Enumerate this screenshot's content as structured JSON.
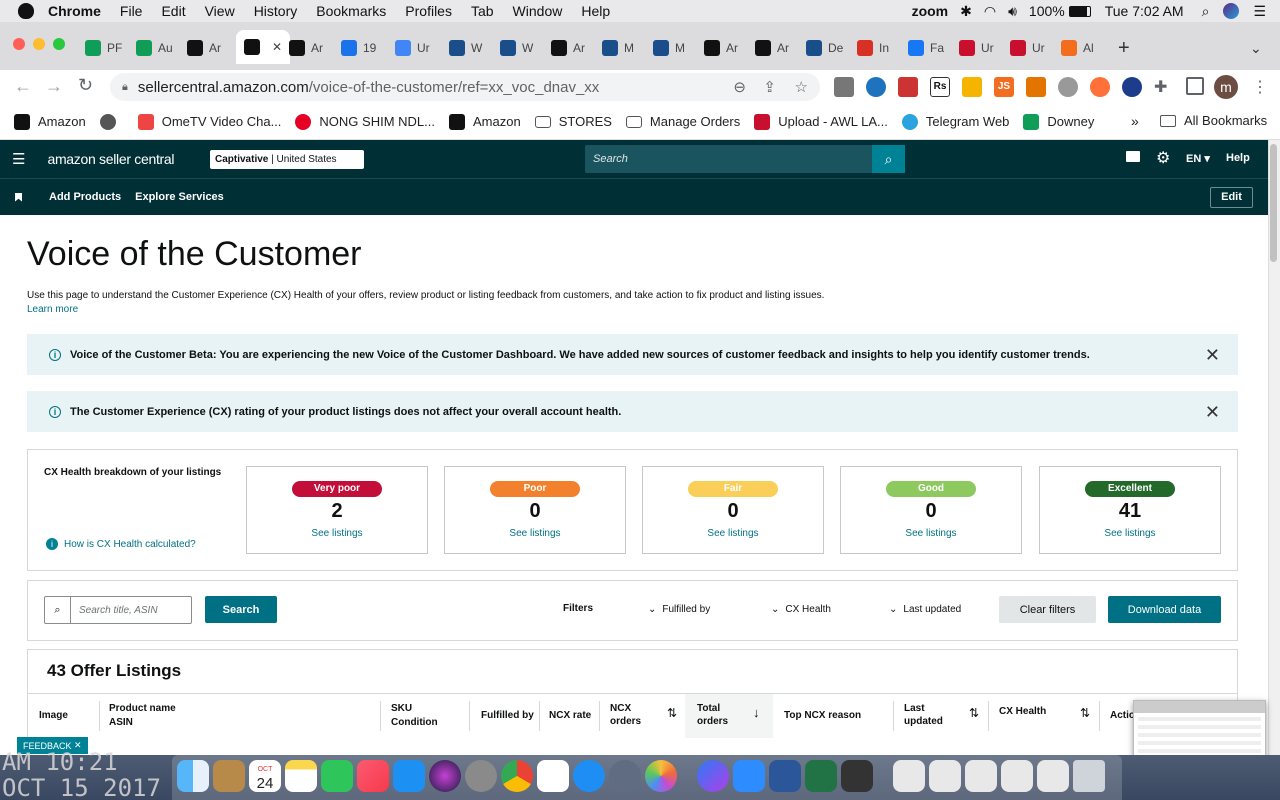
{
  "menubar": {
    "app": "Chrome",
    "items": [
      "File",
      "Edit",
      "View",
      "History",
      "Bookmarks",
      "Profiles",
      "Tab",
      "Window",
      "Help"
    ],
    "zoom": "zoom",
    "battery": "100%",
    "clock": "Tue 7:02 AM"
  },
  "tabs": [
    {
      "label": "PF",
      "icon": "sheets-icon",
      "color": "#0f9d58"
    },
    {
      "label": "Au",
      "icon": "sheets-icon",
      "color": "#0f9d58"
    },
    {
      "label": "Ar",
      "icon": "amazon-icon",
      "color": "#111"
    },
    {
      "label": "",
      "icon": "amazon-icon",
      "color": "#111",
      "active": true
    },
    {
      "label": "Ar",
      "icon": "amazon-icon",
      "color": "#111"
    },
    {
      "label": "19",
      "icon": "badge-icon",
      "color": "#1a73e8"
    },
    {
      "label": "Ur",
      "icon": "docs-icon",
      "color": "#4285f4"
    },
    {
      "label": "W",
      "icon": "cube-icon",
      "color": "#1a4e8a"
    },
    {
      "label": "W",
      "icon": "cube-icon",
      "color": "#1a4e8a"
    },
    {
      "label": "Ar",
      "icon": "amazon-icon",
      "color": "#111"
    },
    {
      "label": "M",
      "icon": "cube-icon",
      "color": "#1a4e8a"
    },
    {
      "label": "M",
      "icon": "cube-icon",
      "color": "#1a4e8a"
    },
    {
      "label": "Ar",
      "icon": "amazon-icon",
      "color": "#111"
    },
    {
      "label": "Ar",
      "icon": "amazon-icon",
      "color": "#111"
    },
    {
      "label": "De",
      "icon": "cube-icon",
      "color": "#1a4e8a"
    },
    {
      "label": "In",
      "icon": "gmail-icon",
      "color": "#d93025"
    },
    {
      "label": "Fa",
      "icon": "facebook-icon",
      "color": "#1877f2"
    },
    {
      "label": "Ur",
      "icon": "awl-icon",
      "color": "#c8102e"
    },
    {
      "label": "Ur",
      "icon": "awl-icon",
      "color": "#c8102e"
    },
    {
      "label": "Al",
      "icon": "pen-icon",
      "color": "#f36d21"
    }
  ],
  "url": {
    "host": "sellercentral.amazon.com",
    "path": "/voice-of-the-customer/ref=xx_voc_dnav_xx"
  },
  "profile_initial": "m",
  "bookmarks": [
    {
      "label": "Amazon",
      "icon": "amazon-icon"
    },
    {
      "label": "",
      "icon": "globe-icon"
    },
    {
      "label": "OmeTV Video Cha...",
      "icon": "ometv-icon"
    },
    {
      "label": "NONG SHIM NDL...",
      "icon": "pinterest-icon"
    },
    {
      "label": "Amazon",
      "icon": "amazon-icon"
    },
    {
      "label": "STORES",
      "icon": "folder-icon"
    },
    {
      "label": "Manage Orders",
      "icon": "folder-icon"
    },
    {
      "label": "Upload - AWL LA...",
      "icon": "awl-icon"
    },
    {
      "label": "Telegram Web",
      "icon": "telegram-icon"
    },
    {
      "label": "Downey",
      "icon": "sheets-icon"
    }
  ],
  "all_bookmarks": "All Bookmarks",
  "sc": {
    "logo": "amazon seller central",
    "store": "Captivative",
    "market": "United States",
    "search_placeholder": "Search",
    "lang": "EN",
    "help": "Help",
    "nav": [
      "Add Products",
      "Explore Services"
    ],
    "edit": "Edit"
  },
  "page": {
    "title": "Voice of the Customer",
    "desc": "Use this page to understand the Customer Experience (CX) Health of your offers, review product or listing feedback from customers, and take action to fix product and listing issues.",
    "learn_more": "Learn more",
    "banner1": "Voice of the Customer Beta: You are experiencing the new Voice of the Customer Dashboard. We have added new sources of customer feedback and insights to help you identify customer trends.",
    "banner2": "The Customer Experience (CX) rating of your product listings does not affect your overall account health.",
    "breakdown_title": "CX Health breakdown of your listings",
    "how_calc": "How is CX Health calculated?",
    "cards": [
      {
        "label": "Very poor",
        "count": "2",
        "see": "See listings",
        "color": "#c40e3a"
      },
      {
        "label": "Poor",
        "count": "0",
        "see": "See listings",
        "color": "#f3802c"
      },
      {
        "label": "Fair",
        "count": "0",
        "see": "See listings",
        "color": "#f9cf59"
      },
      {
        "label": "Good",
        "count": "0",
        "see": "See listings",
        "color": "#8ec95f"
      },
      {
        "label": "Excellent",
        "count": "41",
        "see": "See listings",
        "color": "#23692a"
      }
    ],
    "search_placeholder": "Search title, ASIN",
    "search_btn": "Search",
    "filters": "Filters",
    "filter_fulfilled": "Fulfilled by",
    "filter_cx": "CX Health",
    "filter_updated": "Last updated",
    "clear_filters": "Clear filters",
    "download": "Download data",
    "listings_title": "43 Offer Listings",
    "columns": {
      "image": "Image",
      "product_name": "Product name",
      "asin": "ASIN",
      "sku": "SKU",
      "condition": "Condition",
      "fulfilled": "Fulfilled by",
      "ncx_rate": "NCX rate",
      "ncx_orders_1": "NCX",
      "ncx_orders_2": "orders",
      "total_orders_1": "Total",
      "total_orders_2": "orders",
      "top_reason": "Top NCX reason",
      "last_updated_1": "Last",
      "last_updated_2": "updated",
      "cx_health": "CX Health",
      "actions": "Actions"
    },
    "feedback": "FEEDBACK"
  },
  "desktop_clock": {
    "line1": "AM 10:21",
    "line2": "OCT 15 2017"
  },
  "dock_calendar": {
    "month": "OCT",
    "day": "24"
  }
}
